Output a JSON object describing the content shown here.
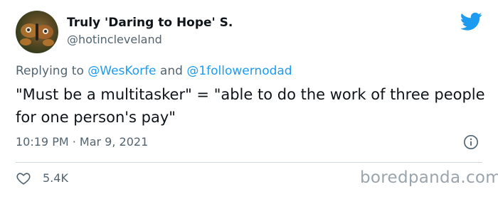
{
  "author": {
    "display_name": "Truly 'Daring to Hope' S.",
    "handle": "@hotincleveland"
  },
  "reply": {
    "prefix": "Replying to ",
    "mention_1": "@WesKorfe",
    "conjunction": " and ",
    "mention_2": "@1followernodad"
  },
  "tweet": {
    "text": "\"Must be a multitasker\" = \"able to do the work of three people for one person's pay\"",
    "timestamp": "10:19 PM · Mar 9, 2021"
  },
  "engagement": {
    "likes": "5.4K"
  },
  "watermark": "boredpanda.com",
  "colors": {
    "twitter_blue": "#1d9bf0",
    "secondary_text": "#536471",
    "divider": "#cfd9de"
  },
  "icons": [
    "avatar-image",
    "twitter-bird-icon",
    "info-icon",
    "heart-icon"
  ]
}
